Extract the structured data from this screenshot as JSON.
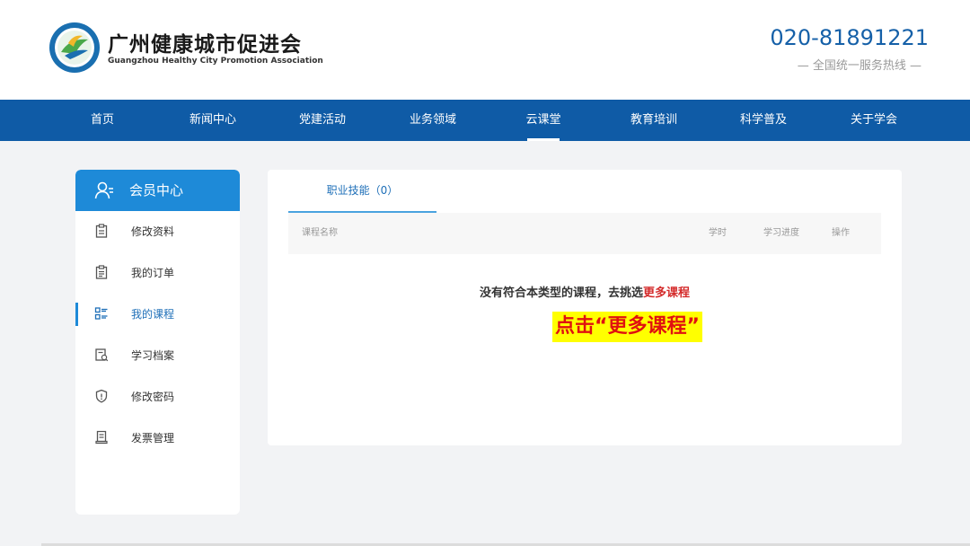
{
  "header": {
    "org_name": "广州健康城市促进会",
    "org_name_en": "Guangzhou Healthy City Promotion Association",
    "hotline_number": "020-81891221",
    "hotline_caption": "— 全国统一服务热线 —"
  },
  "nav": {
    "items": [
      {
        "label": "首页"
      },
      {
        "label": "新闻中心"
      },
      {
        "label": "党建活动"
      },
      {
        "label": "业务领域"
      },
      {
        "label": "云课堂"
      },
      {
        "label": "教育培训"
      },
      {
        "label": "科学普及"
      },
      {
        "label": "关于学会"
      }
    ],
    "active": "云课堂"
  },
  "sidebar": {
    "title": "会员中心",
    "items": [
      {
        "label": "修改资料",
        "icon": "clipboard-icon"
      },
      {
        "label": "我的订单",
        "icon": "order-icon"
      },
      {
        "label": "我的课程",
        "icon": "course-list-icon"
      },
      {
        "label": "学习档案",
        "icon": "archive-icon"
      },
      {
        "label": "修改密码",
        "icon": "shield-icon"
      },
      {
        "label": "发票管理",
        "icon": "invoice-icon"
      }
    ],
    "active": "我的课程"
  },
  "panel": {
    "tab_label": "职业技能（0）",
    "columns": {
      "name": "课程名称",
      "hours": "学时",
      "progress": "学习进度",
      "action": "操作"
    },
    "empty_prefix": "没有符合本类型的课程，去挑选",
    "empty_link": "更多课程",
    "callout": "点击“更多课程”"
  },
  "colors": {
    "brand": "#0f5ba6",
    "accent": "#1e8ad8",
    "link_red": "#d42a2a",
    "highlight": "#ffff00"
  }
}
